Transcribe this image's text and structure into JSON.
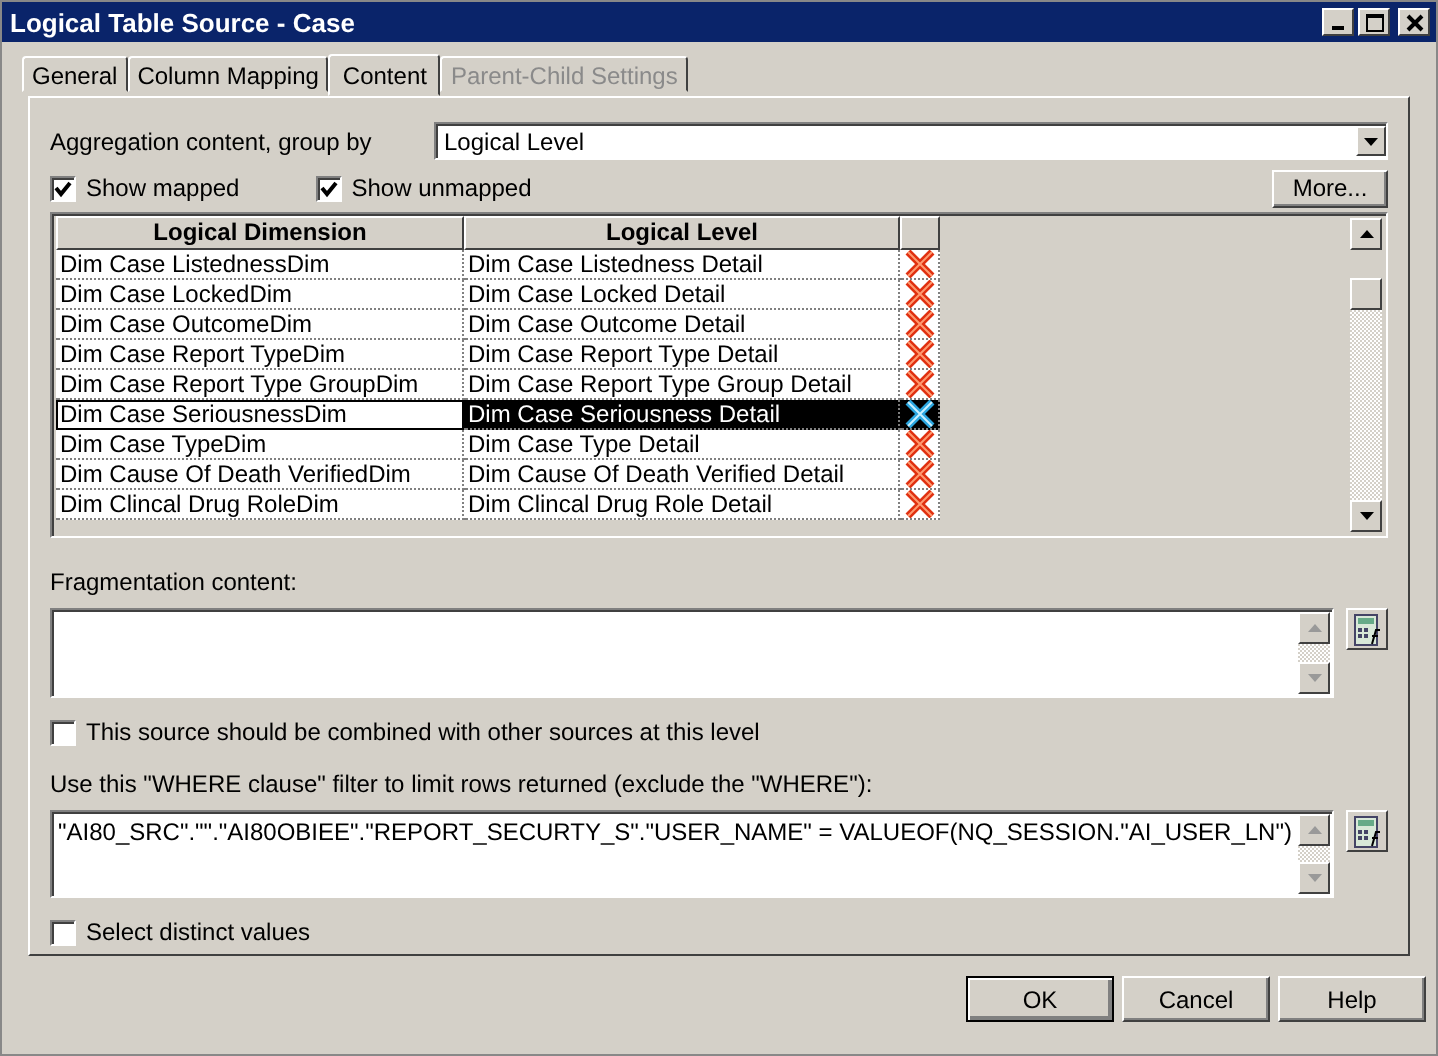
{
  "window": {
    "title": "Logical Table Source - Case"
  },
  "tabs": [
    {
      "label": "General",
      "selected": false,
      "disabled": false
    },
    {
      "label": "Column Mapping",
      "selected": false,
      "disabled": false
    },
    {
      "label": "Content",
      "selected": true,
      "disabled": false
    },
    {
      "label": "Parent-Child Settings",
      "selected": false,
      "disabled": true
    }
  ],
  "aggregation": {
    "label": "Aggregation content, group by",
    "value": "Logical Level"
  },
  "show_mapped": {
    "label": "Show mapped",
    "checked": true
  },
  "show_unmapped": {
    "label": "Show unmapped",
    "checked": true
  },
  "more_button": "More...",
  "table": {
    "columns": [
      "Logical Dimension",
      "Logical Level"
    ],
    "rows": [
      {
        "dimension": "Dim Case ListednessDim",
        "level": "Dim Case Listedness Detail",
        "selected": false
      },
      {
        "dimension": "Dim Case LockedDim",
        "level": "Dim Case Locked Detail",
        "selected": false
      },
      {
        "dimension": "Dim Case OutcomeDim",
        "level": "Dim Case Outcome Detail",
        "selected": false
      },
      {
        "dimension": "Dim Case Report TypeDim",
        "level": "Dim Case Report Type Detail",
        "selected": false
      },
      {
        "dimension": "Dim Case Report Type GroupDim",
        "level": "Dim Case Report Type Group Detail",
        "selected": false
      },
      {
        "dimension": "Dim Case SeriousnessDim",
        "level": "Dim Case Seriousness Detail",
        "selected": true
      },
      {
        "dimension": "Dim Case TypeDim",
        "level": "Dim Case Type Detail",
        "selected": false
      },
      {
        "dimension": "Dim Cause Of Death VerifiedDim",
        "level": "Dim Cause Of Death Verified Detail",
        "selected": false
      },
      {
        "dimension": "Dim Clincal Drug RoleDim",
        "level": "Dim Clincal Drug Role Detail",
        "selected": false
      }
    ]
  },
  "fragmentation": {
    "label": "Fragmentation content:"
  },
  "combine": {
    "label": "This source should be combined with other sources at this level",
    "checked": false
  },
  "where": {
    "label": "Use this \"WHERE clause\" filter to limit rows returned (exclude the \"WHERE\"):",
    "value": "\"AI80_SRC\".\"\".\"AI80OBIEE\".\"REPORT_SECURTY_S\".\"USER_NAME\" =  VALUEOF(NQ_SESSION.\"AI_USER_LN\")"
  },
  "distinct": {
    "label": "Select distinct values",
    "checked": false
  },
  "buttons": [
    "OK",
    "Cancel",
    "Help"
  ]
}
